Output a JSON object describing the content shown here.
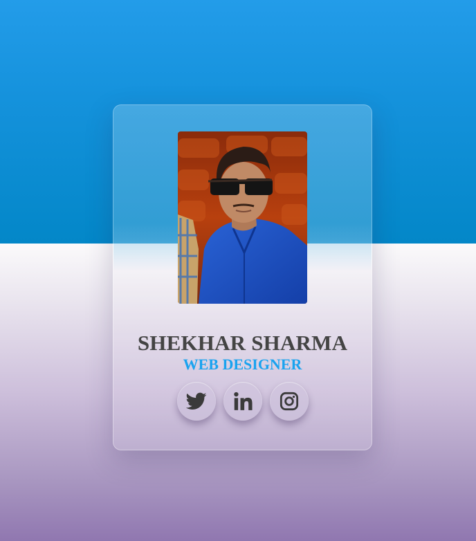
{
  "profile": {
    "name": "SHEKHAR SHARMA",
    "role": "WEB DESIGNER"
  },
  "socials": [
    {
      "icon": "twitter-icon"
    },
    {
      "icon": "linkedin-icon"
    },
    {
      "icon": "instagram-icon"
    }
  ],
  "colors": {
    "background_top": "#1592dc",
    "background_bottom": "#9077b0",
    "name_text": "#444444",
    "role_text": "#1aa3ef",
    "icon": "#3a3a3a"
  }
}
